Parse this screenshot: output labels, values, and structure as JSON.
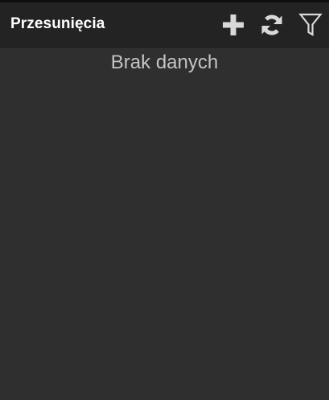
{
  "header": {
    "title": "Przesunięcia",
    "actions": [
      {
        "name": "add",
        "icon": "plus-icon"
      },
      {
        "name": "refresh",
        "icon": "refresh-icon"
      },
      {
        "name": "filter",
        "icon": "filter-icon"
      }
    ]
  },
  "main": {
    "empty_message": "Brak danych"
  },
  "colors": {
    "background": "#2f2f2f",
    "header_background": "#232323",
    "title": "#ffffff",
    "icon": "#d9d9d9",
    "empty_text": "#c4c4c4"
  }
}
